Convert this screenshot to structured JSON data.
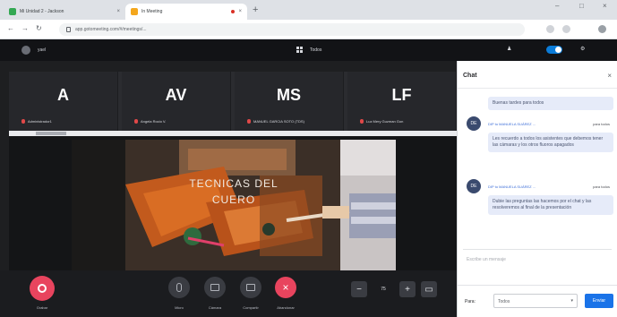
{
  "browser": {
    "tabs": [
      {
        "title": "Mi Unidad 2 - Jackson",
        "active": false
      },
      {
        "title": "In Meeting",
        "active": true
      }
    ],
    "url": "app.gotomeeting.com/#/meetings/..."
  },
  "app": {
    "user": "yael",
    "view_label": "Todos"
  },
  "participants": [
    {
      "initials": "A",
      "name": "Administrador1"
    },
    {
      "initials": "AV",
      "name": "Angela Rocio V."
    },
    {
      "initials": "MS",
      "name": "MANUEL GARCIA SOTO (TDS)"
    },
    {
      "initials": "LF",
      "name": "Luz Mery Guzman Gon"
    }
  ],
  "video": {
    "title_line1": "TECNICAS DEL",
    "title_line2": "CUERO"
  },
  "toolbar": {
    "record_label": "Grabar",
    "mic_label": "Micro",
    "camera_label": "Cámara",
    "share_label": "Compartir",
    "leave_label": "Abandonar",
    "zoom_value": "75"
  },
  "chat": {
    "title": "Chat",
    "messages": [
      {
        "type": "bubble",
        "text": "Buenas tardes para todos"
      },
      {
        "type": "msg",
        "initials": "DE",
        "sender": "DIP to MANUELA SUÁREZ ...",
        "to": "para todos",
        "text": "Les recuerdo a todos los asistentes que debemos tener las cámaras y los otros fluoros apagados"
      },
      {
        "type": "msg",
        "initials": "DE",
        "sender": "DIP to MANUELA SUÁREZ ...",
        "to": "para todos",
        "text": "Dubie las preguntas las hacemos por el chat y las resolveremos al final de la presentación"
      }
    ],
    "input_placeholder": "Escribe un mensaje",
    "para_label": "Para:",
    "recipient": "Todos",
    "send_label": "Enviar"
  }
}
